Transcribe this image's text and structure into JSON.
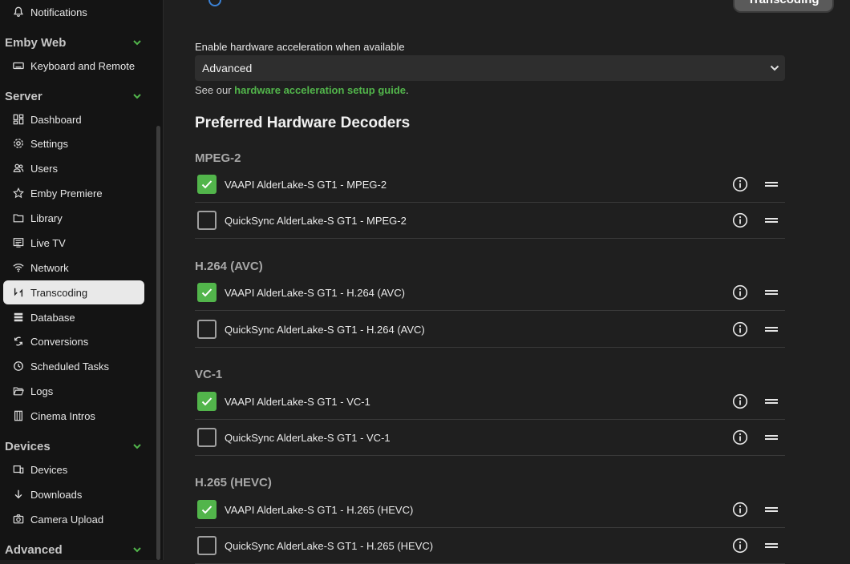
{
  "sidebar": {
    "sections": {
      "emby_web": "Emby Web",
      "server": "Server",
      "devices": "Devices",
      "advanced": "Advanced"
    },
    "items": {
      "notifications": "Notifications",
      "keyboard_remote": "Keyboard and Remote",
      "dashboard": "Dashboard",
      "settings": "Settings",
      "users": "Users",
      "emby_premiere": "Emby Premiere",
      "library": "Library",
      "live_tv": "Live TV",
      "network": "Network",
      "transcoding": "Transcoding",
      "database": "Database",
      "conversions": "Conversions",
      "scheduled_tasks": "Scheduled Tasks",
      "logs": "Logs",
      "cinema_intros": "Cinema Intros",
      "devices": "Devices",
      "downloads": "Downloads",
      "camera_upload": "Camera Upload"
    },
    "active_item": "transcoding"
  },
  "main": {
    "tab_label": "Transcoding",
    "hw_accel_label": "Enable hardware acceleration when available",
    "hw_accel_value": "Advanced",
    "help_prefix": "See our ",
    "help_link": "hardware acceleration setup guide",
    "help_suffix": ".",
    "decoders_heading": "Preferred Hardware Decoders",
    "groups": [
      {
        "title": "MPEG-2",
        "rows": [
          {
            "label": "VAAPI AlderLake-S GT1 - MPEG-2",
            "checked": true
          },
          {
            "label": "QuickSync AlderLake-S GT1 - MPEG-2",
            "checked": false
          }
        ]
      },
      {
        "title": "H.264 (AVC)",
        "rows": [
          {
            "label": "VAAPI AlderLake-S GT1 - H.264 (AVC)",
            "checked": true
          },
          {
            "label": "QuickSync AlderLake-S GT1 - H.264 (AVC)",
            "checked": false
          }
        ]
      },
      {
        "title": "VC-1",
        "rows": [
          {
            "label": "VAAPI AlderLake-S GT1 - VC-1",
            "checked": true
          },
          {
            "label": "QuickSync AlderLake-S GT1 - VC-1",
            "checked": false
          }
        ]
      },
      {
        "title": "H.265 (HEVC)",
        "rows": [
          {
            "label": "VAAPI AlderLake-S GT1 - H.265 (HEVC)",
            "checked": true
          },
          {
            "label": "QuickSync AlderLake-S GT1 - H.265 (HEVC)",
            "checked": false
          }
        ]
      }
    ]
  },
  "colors": {
    "accent": "#52b54b",
    "background": "#1f1f1f",
    "sidebar": "#141414"
  }
}
